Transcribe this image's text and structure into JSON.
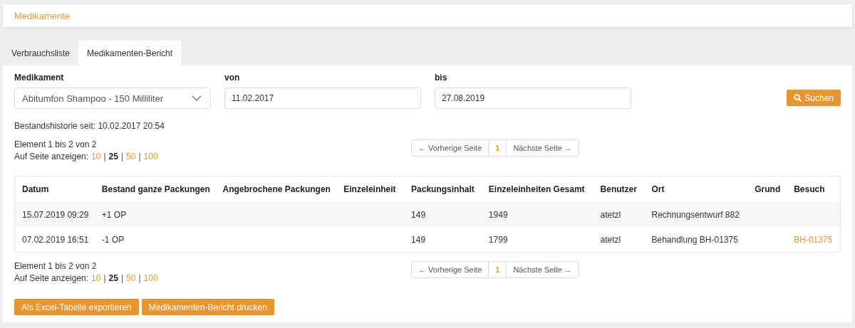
{
  "header": {
    "title": "Medikamente"
  },
  "tabs": [
    {
      "label": "Verbrauchsliste",
      "selected": false
    },
    {
      "label": "Medikamenten-Bericht",
      "selected": true
    }
  ],
  "filters": {
    "medikament": {
      "label": "Medikament",
      "value": "Abitumfon Shampoo - 150 Milliliter"
    },
    "von": {
      "label": "von",
      "value": "11.02.2017"
    },
    "bis": {
      "label": "bis",
      "value": "27.08.2019"
    },
    "search_button": "Suchen"
  },
  "history_note": "Bestandshistorie seit: 10.02.2017 20:54",
  "pager_top": {
    "summary": "Element 1 bis 2 von 2",
    "per_page_label": "Auf Seite anzeigen:",
    "separator": "|",
    "per_page": [
      {
        "label": "10",
        "selected": false
      },
      {
        "label": "25",
        "selected": true
      },
      {
        "label": "50",
        "selected": false
      },
      {
        "label": "100",
        "selected": false
      }
    ],
    "prev": "← Vorherige Seite",
    "page": "1",
    "next": "Nächste Seite →"
  },
  "table": {
    "columns": [
      "Datum",
      "Bestand ganze Packungen",
      "Angebrochene Packungen",
      "Einzeleinheit",
      "Packungsinhalt",
      "Einzeleinheiten Gesamt",
      "Benutzer",
      "Ort",
      "Grund",
      "Besuch"
    ],
    "rows": [
      {
        "cells": [
          {
            "text": "15.07.2019 09:29",
            "kind": "text"
          },
          {
            "text": "+1 OP",
            "kind": "text"
          },
          null,
          null,
          {
            "text": "149",
            "kind": "text"
          },
          {
            "text": "1949",
            "kind": "text"
          },
          {
            "text": "atetzl",
            "kind": "text"
          },
          {
            "text": "Rechnungsentwurf 882",
            "kind": "text"
          },
          null,
          null
        ]
      },
      {
        "cells": [
          {
            "text": "07.02.2019 16:51",
            "kind": "text"
          },
          {
            "text": "-1 OP",
            "kind": "text"
          },
          null,
          null,
          {
            "text": "149",
            "kind": "text"
          },
          {
            "text": "1799",
            "kind": "text"
          },
          {
            "text": "atetzl",
            "kind": "text"
          },
          {
            "text": "Behandlung BH-01375",
            "kind": "text"
          },
          null,
          {
            "text": "BH-01375",
            "kind": "link"
          }
        ]
      }
    ]
  },
  "pager_bottom": {
    "summary": "Element 1 bis 2 von 2",
    "per_page_label": "Auf Seite anzeigen:",
    "separator": "|",
    "per_page": [
      {
        "label": "10",
        "selected": false
      },
      {
        "label": "25",
        "selected": true
      },
      {
        "label": "50",
        "selected": false
      },
      {
        "label": "100",
        "selected": false
      }
    ],
    "prev": "← Vorherige Seite",
    "page": "1",
    "next": "Nächste Seite →"
  },
  "actions": [
    "Als Excel-Tabelle exportieren",
    "Medikamenten-Bericht drucken"
  ]
}
